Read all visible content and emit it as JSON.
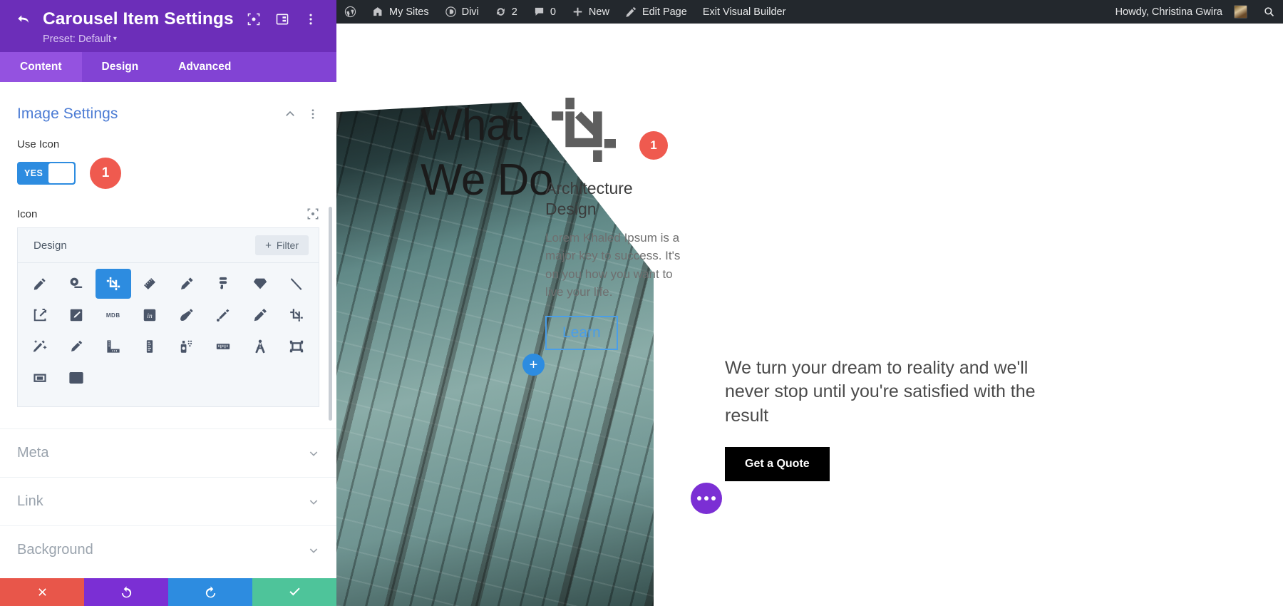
{
  "panel": {
    "title": "Carousel Item Settings",
    "preset": "Preset: Default",
    "header_icons": [
      "target-icon",
      "layout-icon",
      "more-vertical-icon"
    ],
    "tabs": [
      {
        "label": "Content",
        "active": true
      },
      {
        "label": "Design",
        "active": false
      },
      {
        "label": "Advanced",
        "active": false
      }
    ],
    "image_settings": {
      "title": "Image Settings",
      "use_icon_label": "Use Icon",
      "toggle_value": "YES",
      "callout_number": "1",
      "icon_label": "Icon",
      "picker": {
        "category": "Design",
        "filter_label": "Filter",
        "selected_index": 2,
        "icons": [
          "pencil-icon",
          "tape-measure-icon",
          "crop-icon",
          "ruler-icon",
          "marker-icon",
          "figma-icon",
          "sketch-diamond-icon",
          "thin-pen-icon",
          "vector-square-icon",
          "pen-box-icon",
          "mdb-icon",
          "invision-icon",
          "fountain-pen-icon",
          "brush-pen-icon",
          "pencil-alt-icon",
          "crop-alt-icon",
          "magic-wand-icon",
          "pencil-line-icon",
          "ruler-combined-icon",
          "ruler-vertical-icon",
          "spray-can-icon",
          "ruler-horizontal-icon",
          "drafting-compass-icon",
          "frame-icon",
          "frame-corner-icon",
          "frame-image-icon"
        ]
      }
    },
    "accordions": [
      {
        "label": "Meta"
      },
      {
        "label": "Link"
      },
      {
        "label": "Background"
      }
    ],
    "footer_buttons": [
      {
        "name": "cancel",
        "icon": "close-icon",
        "color": "#e8564a"
      },
      {
        "name": "undo",
        "icon": "undo-icon",
        "color": "#7b2fd4"
      },
      {
        "name": "redo",
        "icon": "redo-icon",
        "color": "#2d8ce0"
      },
      {
        "name": "save",
        "icon": "check-icon",
        "color": "#4ec49a"
      }
    ]
  },
  "adminbar": {
    "items": [
      {
        "label": "",
        "icon": "wordpress-icon"
      },
      {
        "label": "My Sites",
        "icon": "sites-icon"
      },
      {
        "label": "Divi",
        "icon": "divi-icon"
      },
      {
        "label": "2",
        "icon": "updates-icon"
      },
      {
        "label": "0",
        "icon": "comments-icon"
      },
      {
        "label": "New",
        "icon": "plus-icon"
      },
      {
        "label": "Edit Page",
        "icon": "edit-icon"
      },
      {
        "label": "Exit Visual Builder",
        "icon": ""
      }
    ],
    "howdy": "Howdy, Christina Gwira",
    "search_icon": "search-icon"
  },
  "canvas": {
    "headline_line1": "What",
    "headline_line2": "We Do",
    "add_button": "+",
    "card": {
      "icon": "crop-icon",
      "badge": "1",
      "title_line1": "Architecture",
      "title_line2": "Design",
      "body": "Lorem Khaled Ipsum is a major key to success. It's on you how you want to live your life.",
      "button_label": "Learn"
    },
    "promo": {
      "text": "We turn your dream to reality and we'll never stop until you're satisfied with the result",
      "button_label": "Get a Quote"
    },
    "fab": "more-options-icon"
  },
  "colors": {
    "panel_header": "#6c2eb9",
    "tabs_bar": "#8243d4",
    "accent_blue": "#2d8ce0",
    "section_title": "#4b7bd4",
    "callout_red": "#ef5a4f",
    "adminbar": "#23282d",
    "fab_purple": "#7b2fd4"
  }
}
